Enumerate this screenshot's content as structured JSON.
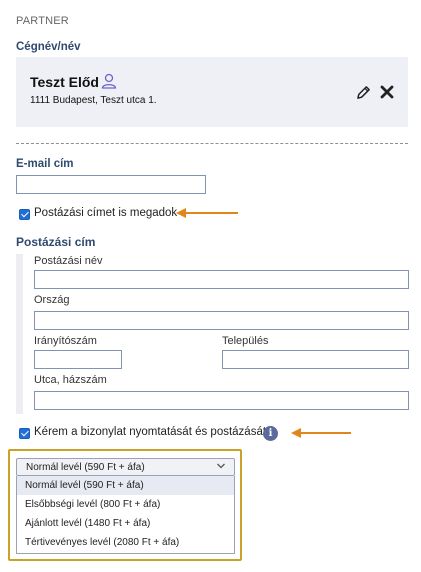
{
  "partner": {
    "section_label": "PARTNER",
    "name_label": "Cégnév/név",
    "name": "Teszt Előd",
    "address": "1111 Budapest, Teszt utca 1."
  },
  "email": {
    "label": "E-mail cím",
    "value": ""
  },
  "postal_toggle": {
    "label": "Postázási címet is megadok",
    "checked": true
  },
  "postal_address": {
    "title": "Postázási cím",
    "name_label": "Postázási név",
    "country_label": "Ország",
    "zip_label": "Irányítószám",
    "city_label": "Település",
    "street_label": "Utca, házszám"
  },
  "print_toggle": {
    "label": "Kérem a bizonylat nyomtatását és postázását",
    "checked": true
  },
  "delivery": {
    "selected": "Normál levél (590 Ft + áfa)",
    "options": [
      "Normál levél (590 Ft + áfa)",
      "Elsőbbségi levél (800 Ft + áfa)",
      "Ajánlott levél (1480 Ft + áfa)",
      "Tértivevényes levél (2080 Ft + áfa)"
    ]
  },
  "colors": {
    "accent": "#1f6fd6",
    "arrow": "#e0861a",
    "frame": "#c9a227",
    "title": "#2f4a6e"
  }
}
